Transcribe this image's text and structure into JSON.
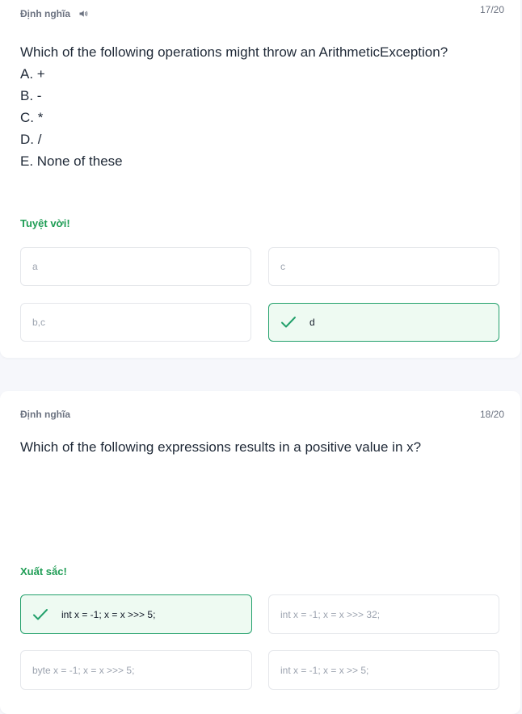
{
  "cards": [
    {
      "label": "Định nghĩa",
      "counter": "17/20",
      "question": "Which of the following operations might throw an ArithmeticException?",
      "options": [
        "A. +",
        "B. -",
        "C. *",
        "D. /",
        "E. None of these"
      ],
      "feedback": "Tuyệt vời!",
      "answers": [
        "a",
        "c",
        "b,c",
        "d"
      ]
    },
    {
      "label": "Định nghĩa",
      "counter": "18/20",
      "question": "Which of the following expressions results in a positive value in x?",
      "feedback": "Xuất sắc!",
      "answers": [
        "int x = -1; x = x >>> 5;",
        "int x = -1; x = x >>> 32;",
        "byte x = -1; x = x >>> 5;",
        "int x = -1; x = x >> 5;"
      ]
    }
  ],
  "colors": {
    "correct_border": "#22a06b",
    "correct_bg": "#eefaf2",
    "feedback": "#1f9d55"
  },
  "icons": {
    "speaker": "speaker-icon",
    "check": "check-icon"
  }
}
